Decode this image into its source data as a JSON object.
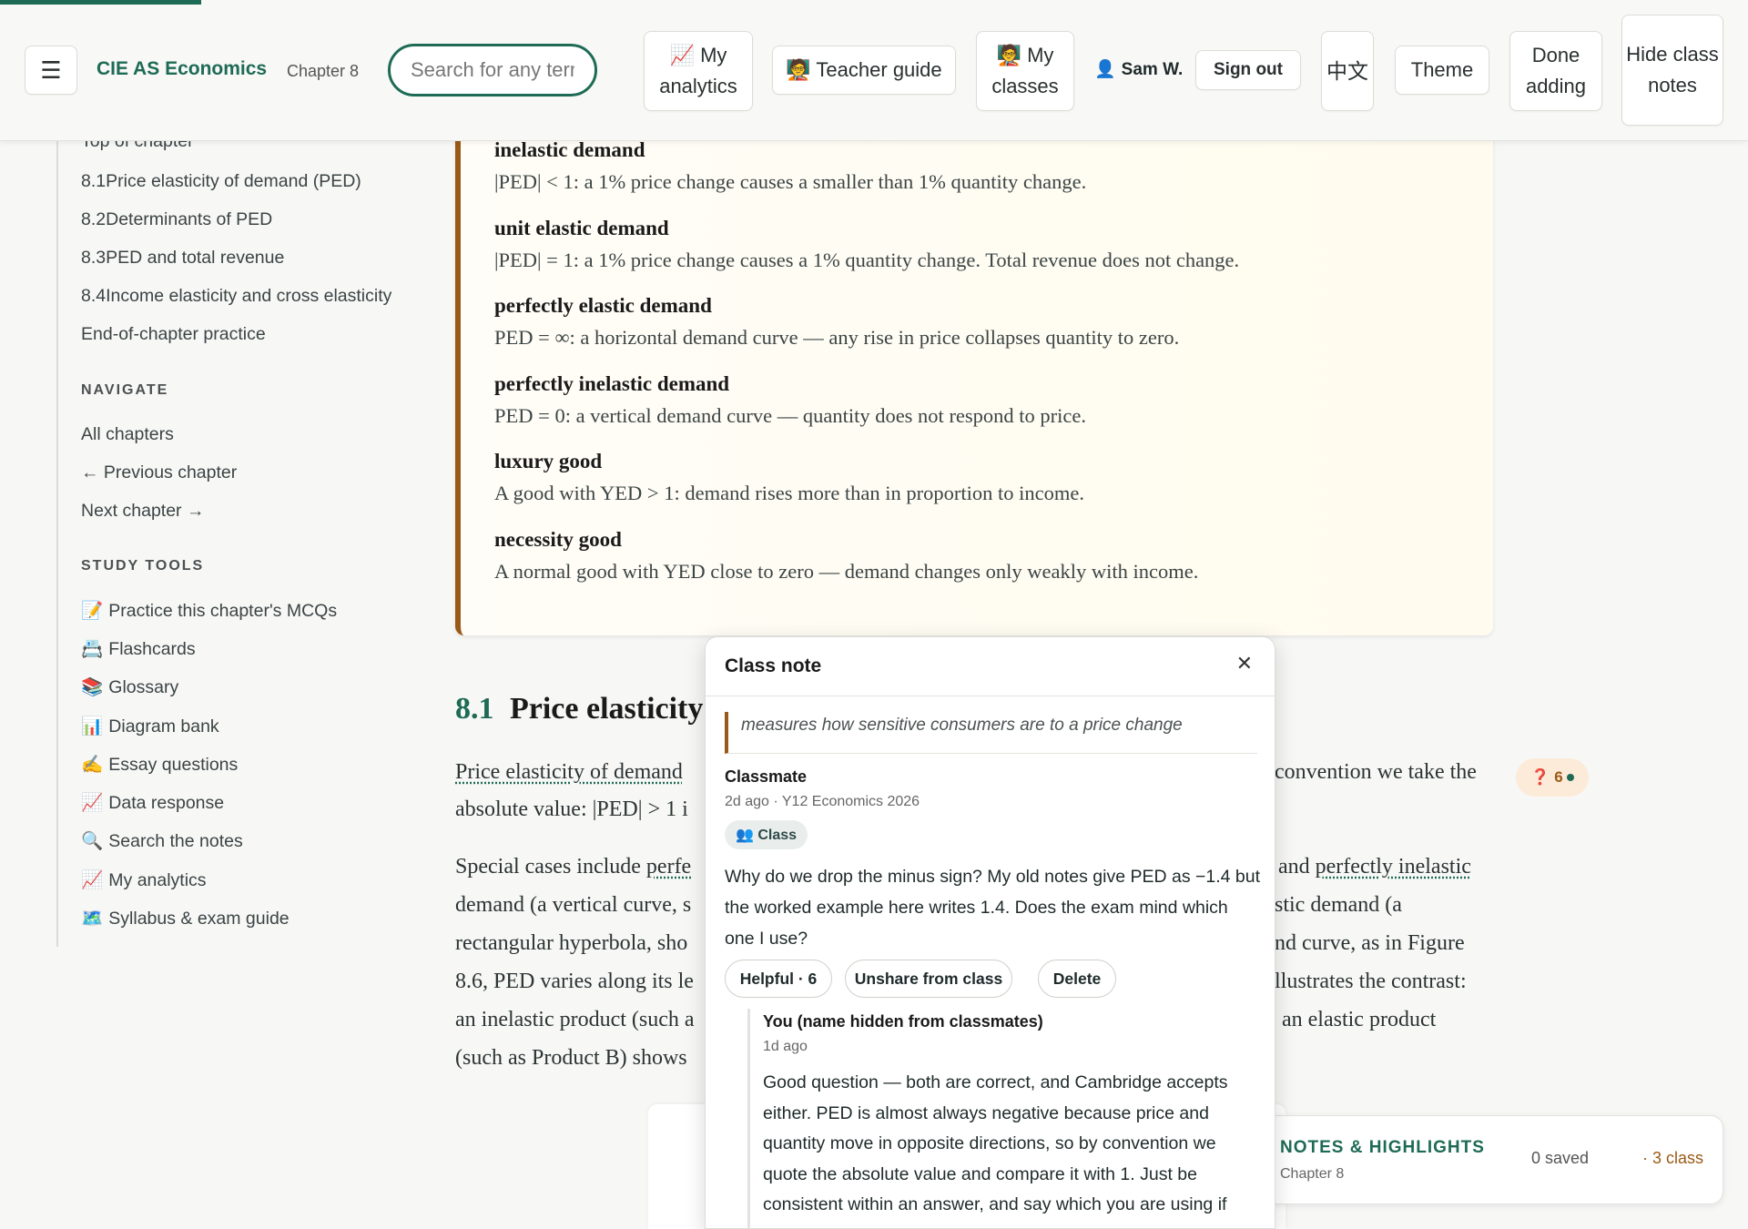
{
  "progress_fraction": 0.115,
  "header": {
    "menu_icon": "☰",
    "brand": "CIE AS Economics",
    "chapter": "Chapter 8",
    "search_placeholder": "Search for any term",
    "analytics": "📈 My analytics",
    "teacher_guide": "🧑‍🏫 Teacher guide",
    "classes": "🧑‍🏫 My classes",
    "user_icon": "👤",
    "user_name": "Sam W.",
    "sign_out": "Sign out",
    "language": "中文",
    "theme": "Theme",
    "done_adding": "Done adding",
    "hide_notes": "Hide class notes"
  },
  "sidebar": {
    "top_link": "Top of chapter",
    "sections": [
      {
        "num": "8.1",
        "label": "Price elasticity of demand (PED)"
      },
      {
        "num": "8.2",
        "label": "Determinants of PED"
      },
      {
        "num": "8.3",
        "label": "PED and total revenue"
      },
      {
        "num": "8.4",
        "label": "Income elasticity and cross elasticity"
      }
    ],
    "practice": "End-of-chapter practice",
    "navigate_heading": "NAVIGATE",
    "navigate": [
      "All chapters",
      "← Previous chapter",
      "Next chapter →"
    ],
    "tools_heading": "STUDY TOOLS",
    "tools": [
      {
        "icon": "📝",
        "label": "Practice this chapter's MCQs"
      },
      {
        "icon": "📇",
        "label": "Flashcards"
      },
      {
        "icon": "📚",
        "label": "Glossary"
      },
      {
        "icon": "📊",
        "label": "Diagram bank"
      },
      {
        "icon": "✍️",
        "label": "Essay questions"
      },
      {
        "icon": "📈",
        "label": "Data response"
      },
      {
        "icon": "🔍",
        "label": "Search the notes"
      },
      {
        "icon": "📈",
        "label": "My analytics"
      },
      {
        "icon": "🗺️",
        "label": "Syllabus & exam guide"
      }
    ]
  },
  "glossary": [
    {
      "term": "inelastic demand",
      "def": "|PED| < 1: a 1% price change causes a smaller than 1% quantity change."
    },
    {
      "term": "unit elastic demand",
      "def": "|PED| = 1: a 1% price change causes a 1% quantity change. Total revenue does not change."
    },
    {
      "term": "perfectly elastic demand",
      "def": "PED = ∞: a horizontal demand curve — any rise in price collapses quantity to zero."
    },
    {
      "term": "perfectly inelastic demand",
      "def": "PED = 0: a vertical demand curve — quantity does not respond to price."
    },
    {
      "term": "luxury good",
      "def": "A good with YED > 1: demand rises more than in proportion to income."
    },
    {
      "term": "necessity good",
      "def": "A normal good with YED close to zero — demand changes only weakly with income."
    }
  ],
  "section": {
    "num": "8.1",
    "title": "Price elasticity",
    "p1": {
      "l1a": "Price elasticity of demand",
      "l1b": "convention we take the",
      "l2a": "absolute value: |PED| > 1 i"
    },
    "p2": {
      "l1a": "Special cases include ",
      "l1a_u": "perfe",
      "l1b": "and ",
      "l1b_u": "perfectly inelastic",
      "l2a": "demand (a vertical curve, s",
      "l2b": "stic demand (a",
      "l3a": "rectangular hyperbola, sho",
      "l3b": "nd curve, as in Figure",
      "l4a": "8.6, PED varies along its le",
      "l4b": "llustrates the contrast:",
      "l5a": "an inelastic product (such a",
      "l5b": "an elastic product",
      "l6a": "(such as Product B) shows"
    }
  },
  "question_badge": {
    "icon": "❓",
    "count": "6"
  },
  "popup": {
    "title": "Class note",
    "close": "✕",
    "quote": "measures how sensitive consumers are to a price change",
    "author": "Classmate",
    "meta": "2d ago · Y12 Economics 2026",
    "chip": "👥 Class",
    "text": "Why do we drop the minus sign? My old notes give PED as −1.4 but the worked example here writes 1.4. Does the exam mind which one I use?",
    "helpful": "Helpful · 6",
    "unshare": "Unshare from class",
    "delete": "Delete",
    "reply_author": "You (name hidden from classmates)",
    "reply_meta": "1d ago",
    "reply_text": "Good question — both are correct, and Cambridge accepts either. PED is almost always negative because price and quantity move in opposite directions, so by convention we quote the absolute value and compare it with 1. Just be consistent within an answer, and say which you are using if you write the minus sign."
  },
  "notes_bar": {
    "title": "NOTES & HIGHLIGHTS",
    "subtitle": "Chapter 8",
    "saved": "0 saved",
    "class": "· 3 class"
  },
  "colors": {
    "accent": "#1e6b55",
    "highlight": "#9a5a17"
  }
}
